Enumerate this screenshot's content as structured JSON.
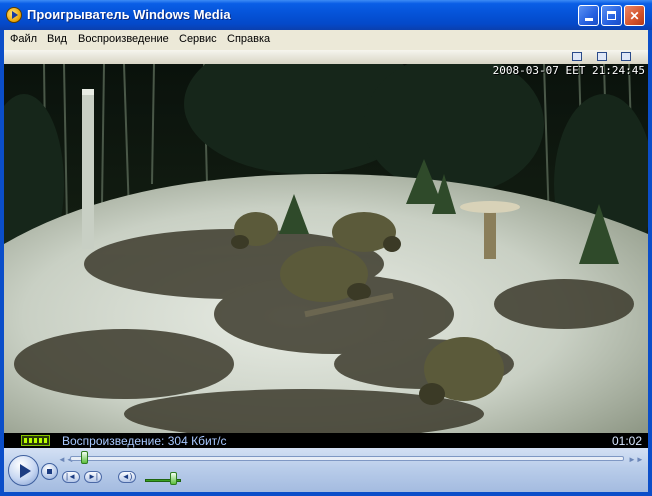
{
  "window": {
    "title": "Проигрыватель Windows Media"
  },
  "menu": {
    "items": [
      "Файл",
      "Вид",
      "Воспроизведение",
      "Сервис",
      "Справка"
    ]
  },
  "video": {
    "timestamp": "2008-03-07 EET 21:24:45"
  },
  "status": {
    "text": "Воспроизведение: 304 Кбит/с",
    "time": "01:02"
  },
  "playback": {
    "seek_fraction": 0.02,
    "volume_fraction": 0.85
  },
  "icons": [
    "app-icon",
    "minimize-icon",
    "maximize-icon",
    "close-icon",
    "play-icon",
    "stop-icon",
    "previous-icon",
    "next-icon",
    "mute-icon"
  ],
  "colors": {
    "titlebar": "#0553d8",
    "status_text": "#a8c8ff",
    "seek_thumb": "#5cbf3c"
  }
}
